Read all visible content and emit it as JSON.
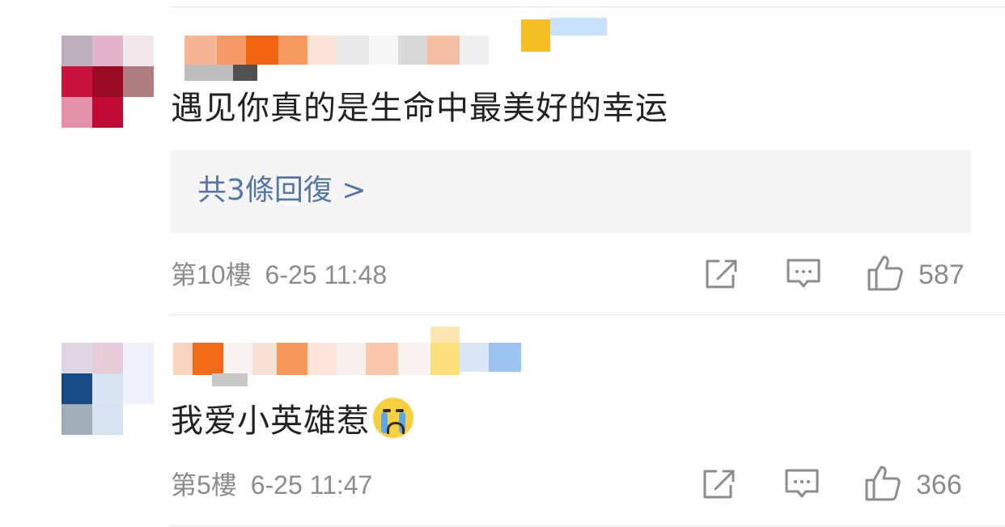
{
  "comments": [
    {
      "text": "遇见你真的是生命中最美好的幸运",
      "replies_label": "共3條回復 >",
      "floor": "第10樓",
      "timestamp": "6-25 11:48",
      "likes": "587"
    },
    {
      "text": "我爱小英雄惹",
      "floor": "第5樓",
      "timestamp": "6-25 11:47",
      "likes": "366"
    }
  ],
  "colors": {
    "link": "#5477a8",
    "meta": "#8c8c8c",
    "text": "#222222",
    "reply_bg": "#f5f5f5"
  },
  "icons": {
    "share": "share-icon",
    "comment": "comment-icon",
    "like": "thumbs-up-icon",
    "emoji": "crying-face-emoji"
  }
}
